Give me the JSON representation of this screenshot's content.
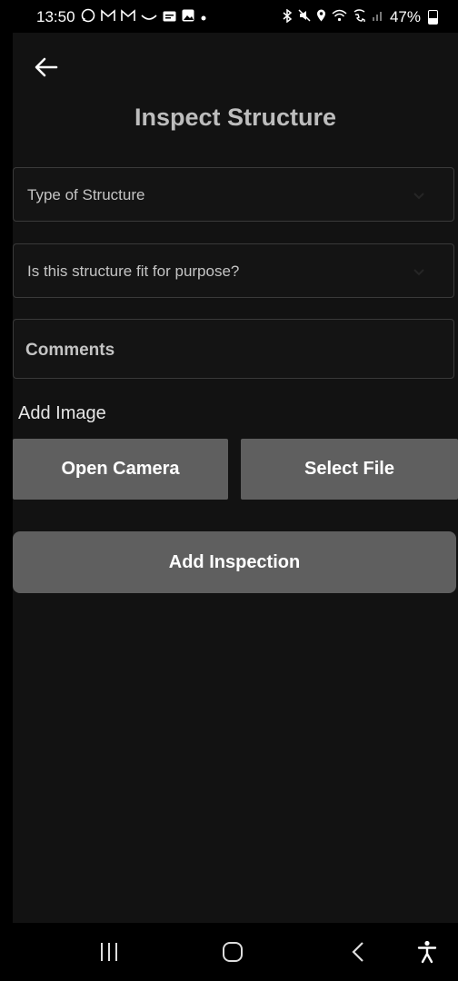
{
  "status_bar": {
    "time": "13:50",
    "notif_icons": [
      "whatsapp-icon",
      "gmail-icon",
      "gmail-icon",
      "voicemail-icon",
      "card-icon",
      "gallery-icon",
      "dot-icon"
    ],
    "system_icons": [
      "bluetooth-icon",
      "mute-icon",
      "location-icon",
      "wifi-icon",
      "wifi-calling-icon",
      "signal-icon",
      "battery-icon"
    ],
    "battery": "47%"
  },
  "header": {
    "back_icon": "back-arrow-icon",
    "title": "Inspect Structure"
  },
  "form": {
    "structure_type": {
      "placeholder": "Type of Structure"
    },
    "fit_for_purpose": {
      "placeholder": "Is this structure fit for purpose?"
    },
    "comments": {
      "placeholder": "Comments"
    },
    "add_image_label": "Add Image",
    "open_camera_label": "Open Camera",
    "select_file_label": "Select File",
    "add_inspection_label": "Add Inspection"
  },
  "colors": {
    "background": "#121212",
    "button": "#5f5f5f",
    "title": "#bdbdbd"
  },
  "nav_bar": {
    "icons": [
      "recent-apps-icon",
      "home-icon",
      "back-icon",
      "accessibility-icon"
    ]
  }
}
